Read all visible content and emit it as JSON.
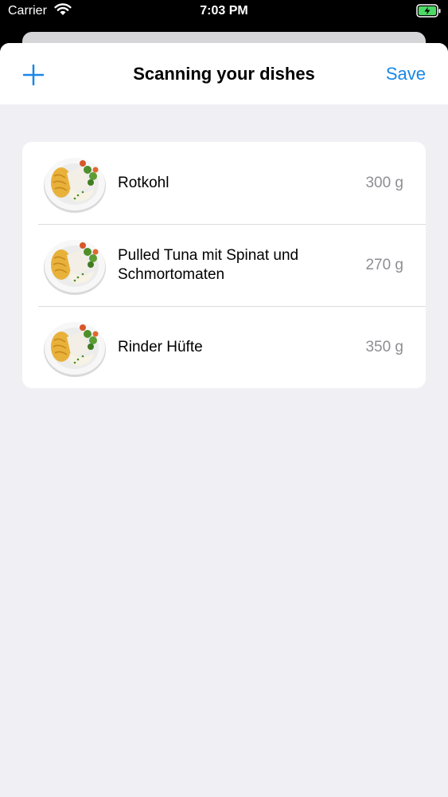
{
  "status_bar": {
    "carrier": "Carrier",
    "time": "7:03 PM"
  },
  "navbar": {
    "title": "Scanning your dishes",
    "save_label": "Save",
    "add_icon": "plus-icon"
  },
  "dishes": [
    {
      "name": "Rotkohl",
      "weight": "300 g"
    },
    {
      "name": "Pulled Tuna mit Spinat und Schmortomaten",
      "weight": "270 g"
    },
    {
      "name": "Rinder Hüfte",
      "weight": "350 g"
    }
  ],
  "colors": {
    "accent": "#1a87e6",
    "background": "#f0eff4",
    "secondary_text": "#8e8e93",
    "battery": "#4cd964"
  }
}
